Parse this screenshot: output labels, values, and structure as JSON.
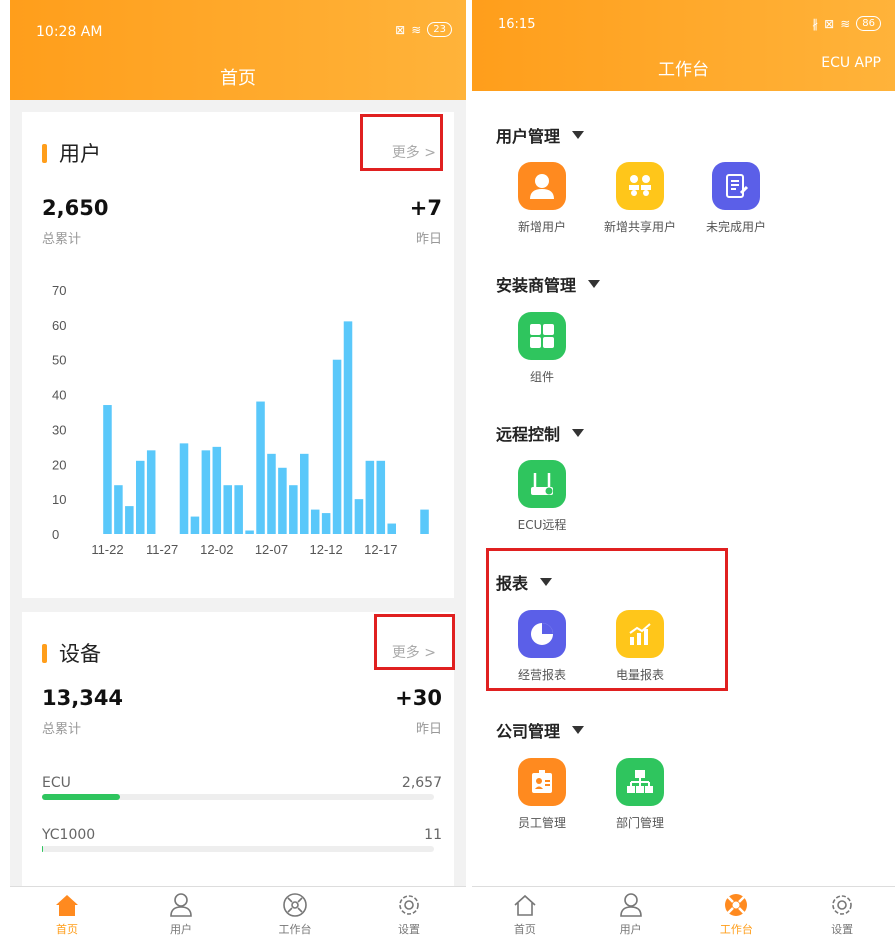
{
  "left": {
    "status": {
      "time": "10:28 AM",
      "battery": "23"
    },
    "title": "首页",
    "user_card": {
      "title": "用户",
      "more": "更多 >",
      "total": "2,650",
      "total_label": "总累计",
      "delta": "+7",
      "delta_label": "昨日"
    },
    "device_card": {
      "title": "设备",
      "more": "更多 >",
      "total": "13,344",
      "total_label": "总累计",
      "delta": "+30",
      "delta_label": "昨日",
      "rows": [
        {
          "label": "ECU",
          "value": "2,657",
          "fraction": 0.2
        },
        {
          "label": "YC1000",
          "value": "11",
          "fraction": 0.003
        }
      ]
    },
    "tabs": [
      "首页",
      "用户",
      "工作台",
      "设置"
    ]
  },
  "chart_data": {
    "type": "bar",
    "categories": [
      "11-22",
      "11-23",
      "11-24",
      "11-25",
      "11-26",
      "11-27",
      "11-28",
      "11-29",
      "11-30",
      "12-01",
      "12-02",
      "12-03",
      "12-04",
      "12-05",
      "12-06",
      "12-07",
      "12-08",
      "12-09",
      "12-10",
      "12-11",
      "12-12",
      "12-13",
      "12-14",
      "12-15",
      "12-16",
      "12-17",
      "12-18",
      "12-19",
      "12-20",
      "12-21"
    ],
    "values": [
      37,
      14,
      8,
      21,
      24,
      0,
      0,
      26,
      5,
      24,
      25,
      14,
      14,
      1,
      38,
      23,
      19,
      14,
      23,
      7,
      6,
      50,
      61,
      10,
      21,
      21,
      3,
      0,
      0,
      7
    ],
    "x_tick_labels": [
      "11-22",
      "11-27",
      "12-02",
      "12-07",
      "12-12",
      "12-17"
    ],
    "y_ticks": [
      "0",
      "10",
      "20",
      "30",
      "40",
      "50",
      "60",
      "70"
    ],
    "ylim": [
      0,
      70
    ],
    "color": "#5ac8fa"
  },
  "right": {
    "status": {
      "time": "16:15",
      "battery": "86"
    },
    "title": "工作台",
    "header_right": "ECU APP",
    "sections": [
      {
        "title": "用户管理",
        "apps": [
          {
            "label": "新增用户",
            "icon": "user-icon",
            "color": "#ff8a1f"
          },
          {
            "label": "新增共享用户",
            "icon": "shared-users-icon",
            "color": "#ffc61a"
          },
          {
            "label": "未完成用户",
            "icon": "document-edit-icon",
            "color": "#5b5fe8"
          }
        ]
      },
      {
        "title": "安装商管理",
        "apps": [
          {
            "label": "组件",
            "icon": "grid-icon",
            "color": "#2fc55e"
          }
        ]
      },
      {
        "title": "远程控制",
        "apps": [
          {
            "label": "ECU远程",
            "icon": "router-icon",
            "color": "#2fc55e"
          }
        ]
      },
      {
        "title": "报表",
        "apps": [
          {
            "label": "经营报表",
            "icon": "pie-chart-icon",
            "color": "#5b5fe8"
          },
          {
            "label": "电量报表",
            "icon": "bar-chart-icon",
            "color": "#ffc61a"
          }
        ]
      },
      {
        "title": "公司管理",
        "apps": [
          {
            "label": "员工管理",
            "icon": "id-card-icon",
            "color": "#ff8a1f"
          },
          {
            "label": "部门管理",
            "icon": "org-chart-icon",
            "color": "#2fc55e"
          }
        ]
      }
    ],
    "tabs": [
      "首页",
      "用户",
      "工作台",
      "设置"
    ]
  }
}
